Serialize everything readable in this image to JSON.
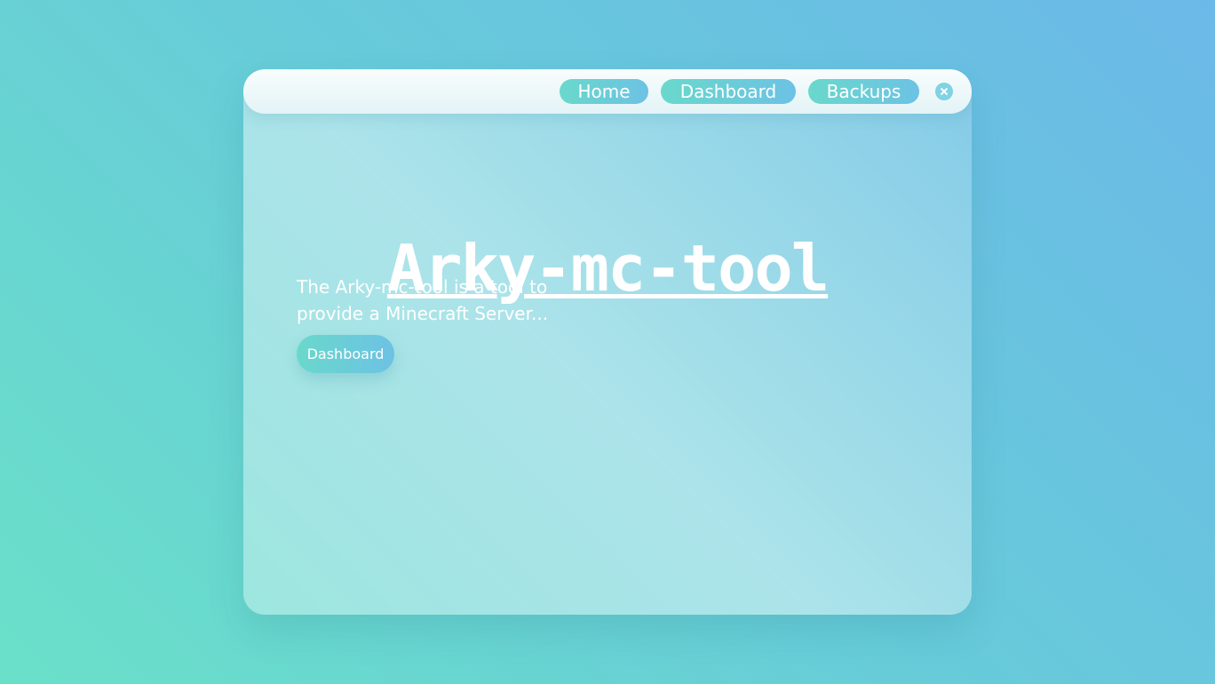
{
  "nav": {
    "items": [
      {
        "label": "Home"
      },
      {
        "label": "Dashboard"
      },
      {
        "label": "Backups"
      }
    ],
    "close_icon": "close-icon"
  },
  "hero": {
    "title": "Arky-mc-tool",
    "description": "The Arky-mc-tool is a tool to provide a Minecraft Server...",
    "cta_label": "Dashboard"
  },
  "colors": {
    "background_start": "#6ae0c9",
    "background_end": "#6bb9e8",
    "button_gradient_start": "#6ad8cb",
    "button_gradient_end": "#6cc2e4",
    "text": "#ffffff"
  }
}
